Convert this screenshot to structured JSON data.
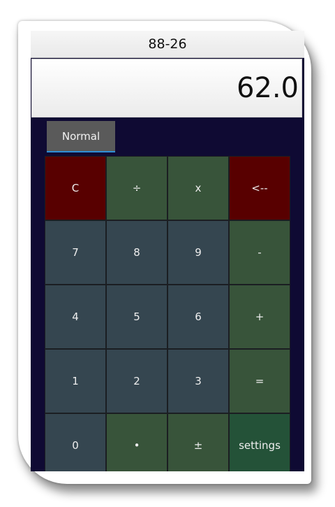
{
  "expression": "88-26",
  "result": "62.0",
  "mode_tab": "Normal",
  "keys": [
    {
      "label": "C",
      "name": "clear-button",
      "style": "red"
    },
    {
      "label": "÷",
      "name": "divide-button",
      "style": "green"
    },
    {
      "label": "x",
      "name": "multiply-button",
      "style": "green"
    },
    {
      "label": "<--",
      "name": "backspace-button",
      "style": "red"
    },
    {
      "label": "7",
      "name": "digit-7-button",
      "style": "slate"
    },
    {
      "label": "8",
      "name": "digit-8-button",
      "style": "slate"
    },
    {
      "label": "9",
      "name": "digit-9-button",
      "style": "slate"
    },
    {
      "label": "-",
      "name": "subtract-button",
      "style": "green"
    },
    {
      "label": "4",
      "name": "digit-4-button",
      "style": "slate"
    },
    {
      "label": "5",
      "name": "digit-5-button",
      "style": "slate"
    },
    {
      "label": "6",
      "name": "digit-6-button",
      "style": "slate"
    },
    {
      "label": "+",
      "name": "add-button",
      "style": "green"
    },
    {
      "label": "1",
      "name": "digit-1-button",
      "style": "slate"
    },
    {
      "label": "2",
      "name": "digit-2-button",
      "style": "slate"
    },
    {
      "label": "3",
      "name": "digit-3-button",
      "style": "slate"
    },
    {
      "label": "=",
      "name": "equals-button",
      "style": "green"
    },
    {
      "label": "0",
      "name": "digit-0-button",
      "style": "slate"
    },
    {
      "label": "•",
      "name": "decimal-point-button",
      "style": "green"
    },
    {
      "label": "±",
      "name": "plus-minus-button",
      "style": "green"
    },
    {
      "label": "settings",
      "name": "settings-button",
      "style": "settings"
    }
  ],
  "colors": {
    "background": "#0f0a33",
    "key_red": "#580000",
    "key_green": "#38543a",
    "key_slate": "#354650",
    "key_settings": "#245238",
    "tab_underline": "#2e8fd6"
  }
}
